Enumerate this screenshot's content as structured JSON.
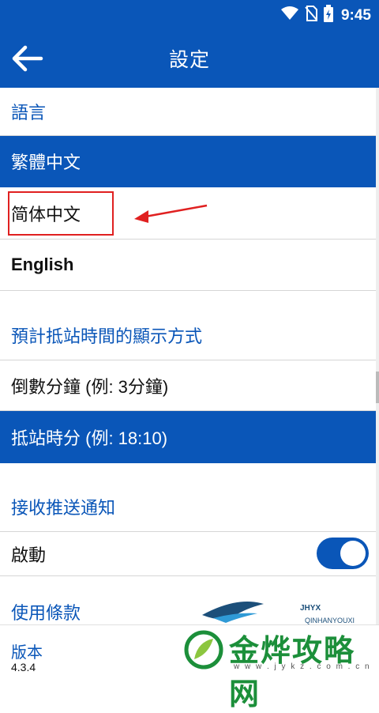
{
  "status": {
    "time": "9:45"
  },
  "appbar": {
    "title": "設定"
  },
  "sections": {
    "language_header": "語言",
    "language_options": [
      "繁體中文",
      "简体中文",
      "English"
    ],
    "arrival_header": "預計抵站時間的顯示方式",
    "arrival_options": [
      "倒數分鐘 (例: 3分鐘)",
      "抵站時分 (例: 18:10)"
    ],
    "notify_header": "接收推送通知",
    "notify_enable": "啟動",
    "terms_header": "使用條款"
  },
  "version": {
    "label": "版本",
    "number": "4.3.4"
  },
  "watermark": {
    "brand": "金烨攻略网",
    "logo_text": "JHYX",
    "logo_sub": "QINHANYOUXI",
    "url": "w w w . j y k z . c o m . c n"
  },
  "colors": {
    "primary": "#0a56b8",
    "annotation": "#e02020"
  }
}
